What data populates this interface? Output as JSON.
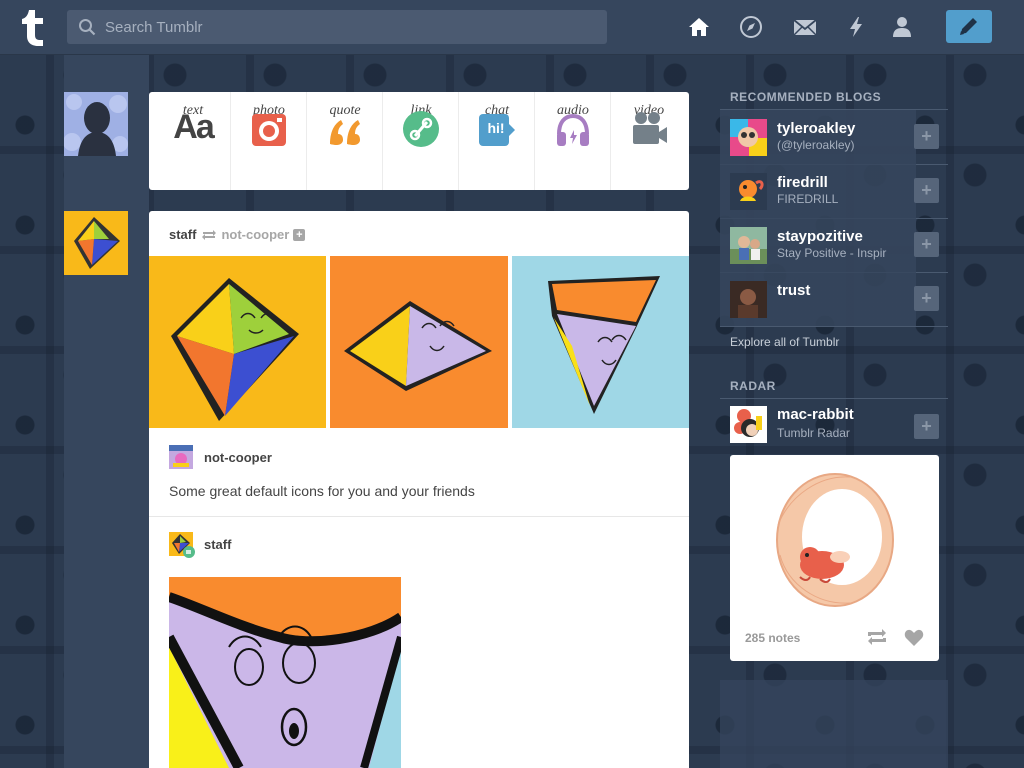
{
  "header": {
    "search_placeholder": "Search Tumblr",
    "nav_icons": [
      "home-icon",
      "explore-icon",
      "mail-icon",
      "activity-icon",
      "account-icon"
    ],
    "compose_icon": "pencil-icon",
    "accent_color": "#529ecc"
  },
  "post_types": [
    {
      "label": "text",
      "icon_text": "Aa",
      "color": "#444444"
    },
    {
      "label": "photo",
      "color": "#e8604b"
    },
    {
      "label": "quote",
      "color": "#f2992e"
    },
    {
      "label": "link",
      "color": "#56bc8a"
    },
    {
      "label": "chat",
      "icon_text": "hi!",
      "color": "#529ecc"
    },
    {
      "label": "audio",
      "color": "#a77dc2"
    },
    {
      "label": "video",
      "color": "#748089"
    }
  ],
  "post": {
    "author": "staff",
    "reblogged_from": "not-cooper",
    "photo_colors": [
      "#f9b919",
      "#f98b2e",
      "#9fd7e6"
    ],
    "trail": [
      {
        "name": "not-cooper",
        "body": "Some great default icons for you and your friends"
      },
      {
        "name": "staff"
      }
    ]
  },
  "sidebar": {
    "recommended_title": "RECOMMENDED BLOGS",
    "recommended": [
      {
        "name": "tyleroakley",
        "subtitle": "(@tyleroakley)"
      },
      {
        "name": "firedrill",
        "subtitle": "FIREDRILL"
      },
      {
        "name": "staypozitive",
        "subtitle": "Stay Positive - Inspir"
      },
      {
        "name": "trust",
        "subtitle": ""
      }
    ],
    "follow_label": "+",
    "explore_label": "Explore all of Tumblr",
    "radar_title": "RADAR",
    "radar": {
      "name": "mac-rabbit",
      "subtitle": "Tumblr Radar",
      "notes": "285 notes"
    }
  }
}
